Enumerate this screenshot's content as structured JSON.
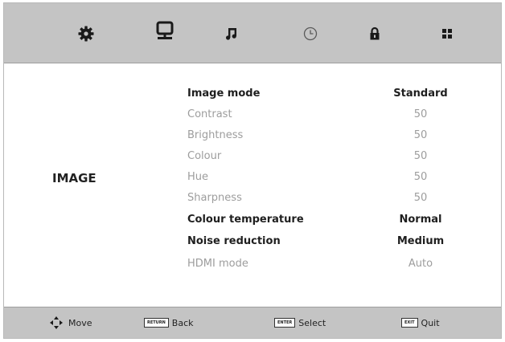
{
  "tabs": [
    {
      "name": "picture-settings",
      "icon": "gear-icon"
    },
    {
      "name": "image",
      "icon": "monitor-icon",
      "selected": true
    },
    {
      "name": "sound",
      "icon": "music-note-icon"
    },
    {
      "name": "time",
      "icon": "clock-icon"
    },
    {
      "name": "lock",
      "icon": "lock-icon"
    },
    {
      "name": "setup",
      "icon": "grid-icon"
    }
  ],
  "menu": {
    "section_title": "IMAGE",
    "items": [
      {
        "label": "Image mode",
        "value": "Standard",
        "enabled": true
      },
      {
        "label": "Contrast",
        "value": "50",
        "enabled": false
      },
      {
        "label": "Brightness",
        "value": "50",
        "enabled": false
      },
      {
        "label": "Colour",
        "value": "50",
        "enabled": false
      },
      {
        "label": "Hue",
        "value": "50",
        "enabled": false
      },
      {
        "label": "Sharpness",
        "value": "50",
        "enabled": false
      },
      {
        "label": "Colour temperature",
        "value": "Normal",
        "enabled": true
      },
      {
        "label": "Noise reduction",
        "value": "Medium",
        "enabled": true
      },
      {
        "label": "HDMI mode",
        "value": "Auto",
        "enabled": false
      }
    ]
  },
  "footer": {
    "move": {
      "label": "Move",
      "icon": "dpad-arrows-icon"
    },
    "back": {
      "key": "RETURN",
      "label": "Back"
    },
    "select": {
      "key": "ENTER",
      "label": "Select"
    },
    "quit": {
      "key": "EXIT",
      "label": "Quit"
    }
  },
  "colors": {
    "bar_background": "#c4c4c4",
    "text_active": "#1f1f1f",
    "text_disabled": "#9d9d9d",
    "icon": "#1a1a1a"
  }
}
